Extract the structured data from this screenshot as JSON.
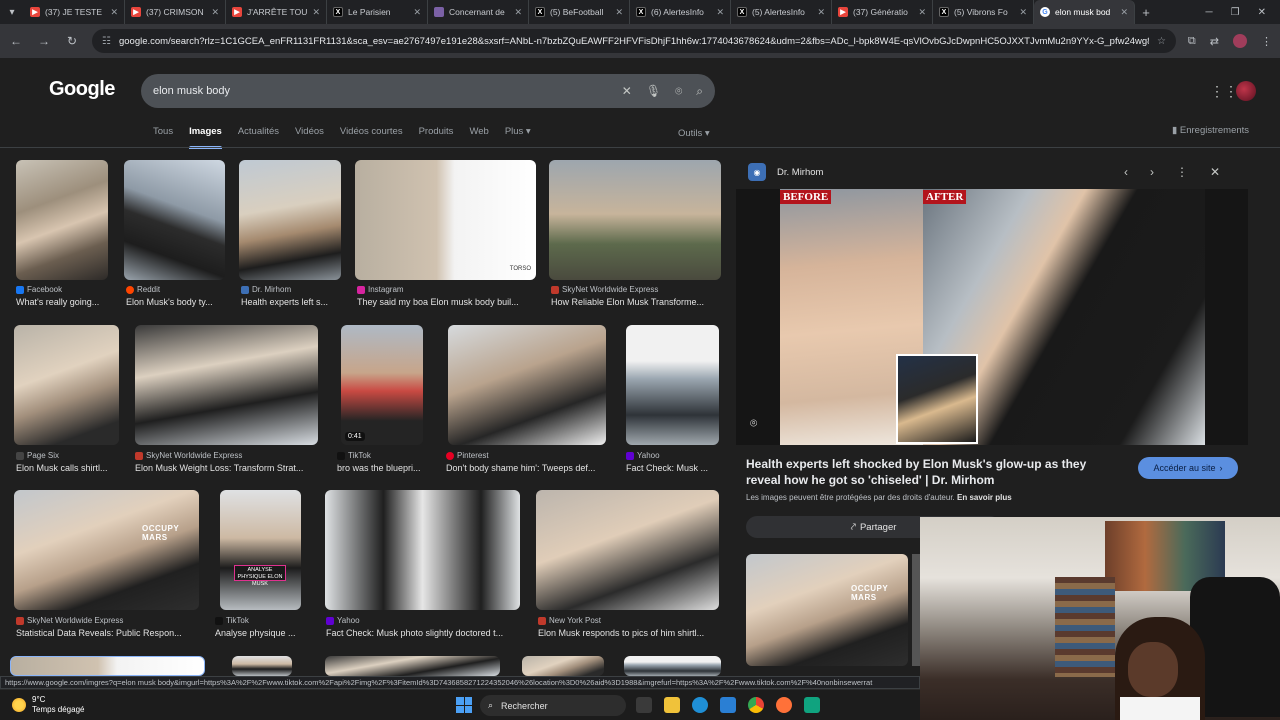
{
  "browser": {
    "tabs": [
      {
        "title": "(37) JE TESTE L",
        "icon": "youtube-icon"
      },
      {
        "title": "(37) CRIMSON",
        "icon": "youtube-icon"
      },
      {
        "title": "J'ARRÊTE TOUT",
        "icon": "youtube-icon"
      },
      {
        "title": "Le Parisien",
        "icon": "x-icon"
      },
      {
        "title": "Concernant de",
        "icon": "twitch-icon"
      },
      {
        "title": "(5) BeFootball",
        "icon": "x-icon"
      },
      {
        "title": "(6) AlertesInfo",
        "icon": "x-icon"
      },
      {
        "title": "(5) AlertesInfo",
        "icon": "x-icon"
      },
      {
        "title": "(37) Génératio",
        "icon": "youtube-icon"
      },
      {
        "title": "(5) Vibrons Fo",
        "icon": "x-icon"
      },
      {
        "title": "elon musk bod",
        "icon": "google-icon",
        "active": true
      }
    ],
    "url": "google.com/search?rlz=1C1GCEA_enFR1131FR1131&sca_esv=ae2767497e191e28&sxsrf=ANbL-n7bzbZQuEAWFF2HFVFisDhjF1hh6w:1774043678624&udm=2&fbs=ADc_l-bpk8W4E-qsVlOvbGJcDwpnHC5OJXXTJvmMu2n9YYx-G_pfw24wg8jEi34E91xB..."
  },
  "google": {
    "logo": "Google",
    "query": "elon musk body",
    "tabs": [
      "Tous",
      "Images",
      "Actualités",
      "Vidéos",
      "Vidéos courtes",
      "Produits",
      "Web",
      "Plus"
    ],
    "active_tab": "Images",
    "tools": "Outils",
    "saved": "Enregistrements"
  },
  "results": [
    {
      "source": "Facebook",
      "caption": "What's really going...",
      "src_color": "#1877f2"
    },
    {
      "source": "Reddit",
      "caption": "Elon Musk's body ty...",
      "src_color": "#ff4500"
    },
    {
      "source": "Dr. Mirhom",
      "caption": "Health experts left s...",
      "src_color": "#3d6fb5"
    },
    {
      "source": "Instagram",
      "caption": "They said my boa Elon musk body buil...",
      "src_color": "#d6249f"
    },
    {
      "source": "SkyNet Worldwide Express",
      "caption": "How Reliable Elon Musk Transforme...",
      "src_color": "#c0392b"
    },
    {
      "source": "Page Six",
      "caption": "Elon Musk calls shirtl...",
      "src_color": "#444444"
    },
    {
      "source": "SkyNet Worldwide Express",
      "caption": "Elon Musk Weight Loss: Transform Strat...",
      "src_color": "#c0392b"
    },
    {
      "source": "TikTok",
      "caption": "bro was the bluepri...",
      "src_color": "#111111",
      "duration": "0:41"
    },
    {
      "source": "Pinterest",
      "caption": "Don't body shame him': Tweeps def...",
      "src_color": "#e60023"
    },
    {
      "source": "Yahoo",
      "caption": "Fact Check: Musk ...",
      "src_color": "#6001d2"
    },
    {
      "source": "SkyNet Worldwide Express",
      "caption": "Statistical Data Reveals: Public Respon...",
      "src_color": "#c0392b"
    },
    {
      "source": "TikTok",
      "caption": "Analyse physique ...",
      "src_color": "#111111",
      "tag": "ANALYSE PHYSIQUE ELON MUSK"
    },
    {
      "source": "Yahoo",
      "caption": "Fact Check: Musk photo slightly doctored t...",
      "src_color": "#6001d2"
    },
    {
      "source": "New York Post",
      "caption": "Elon Musk responds to pics of him shirtl...",
      "src_color": "#c0392b"
    }
  ],
  "thumb_text": {
    "occupy_mars": "OCCUPY MARS",
    "tesla": "TORSO"
  },
  "panel": {
    "source": "Dr. Mirhom",
    "before": "BEFORE",
    "after": "AFTER",
    "title": "Health experts left shocked by Elon Musk's glow-up as they reveal how he got so 'chiseled' | Dr. Mirhom",
    "note": "Les images peuvent être protégées par des droits d'auteur.",
    "note_link": "En savoir plus",
    "visit": "Accéder au site",
    "share": "Partager"
  },
  "status_url": "https://www.google.com/imgres?q=elon musk body&imgurl=https%3A%2F%2Fwww.tiktok.com%2Fapi%2Fimg%2F%3FitemId%3D7436858271224352046%26location%3D0%26aid%3D1988&imgrefurl=https%3A%2F%2Fwww.tiktok.com%2F%40nonbinsewerrat",
  "taskbar": {
    "temp": "9°C",
    "weather": "Temps dégagé",
    "search": "Rechercher"
  },
  "colors": {
    "accent": "#8ab4f8",
    "visit_button": "#5b8fe0",
    "background": "#1f1f1f"
  }
}
